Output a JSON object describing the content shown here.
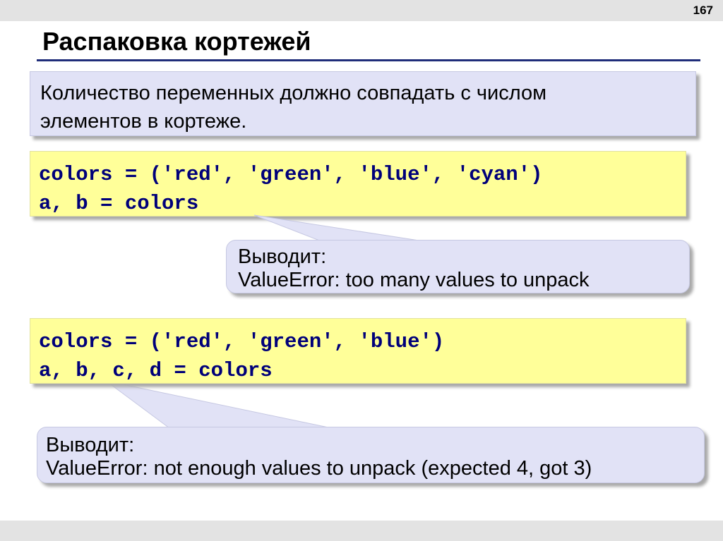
{
  "page": {
    "number": "167"
  },
  "title": "Распаковка кортежей",
  "note": {
    "lines": [
      "Количество переменных должно совпадать с числом",
      "элементов в кортеже."
    ]
  },
  "example1": {
    "code": [
      "colors = ('red', 'green', 'blue', 'cyan')",
      "a, b = colors"
    ],
    "callout": [
      "Выводит:",
      "ValueError: too many values to unpack"
    ]
  },
  "example2": {
    "code": [
      "colors = ('red', 'green', 'blue')",
      "a, b, c, d = colors"
    ],
    "callout": [
      "Выводит:",
      "ValueError: not enough values to unpack (expected 4, got 3)"
    ]
  },
  "colors": {
    "title_rule": "#1f2d7a",
    "code_background": "#ffff99",
    "code_text": "#00007a",
    "callout_background": "#e1e2f6",
    "band": "#e3e3e3"
  }
}
